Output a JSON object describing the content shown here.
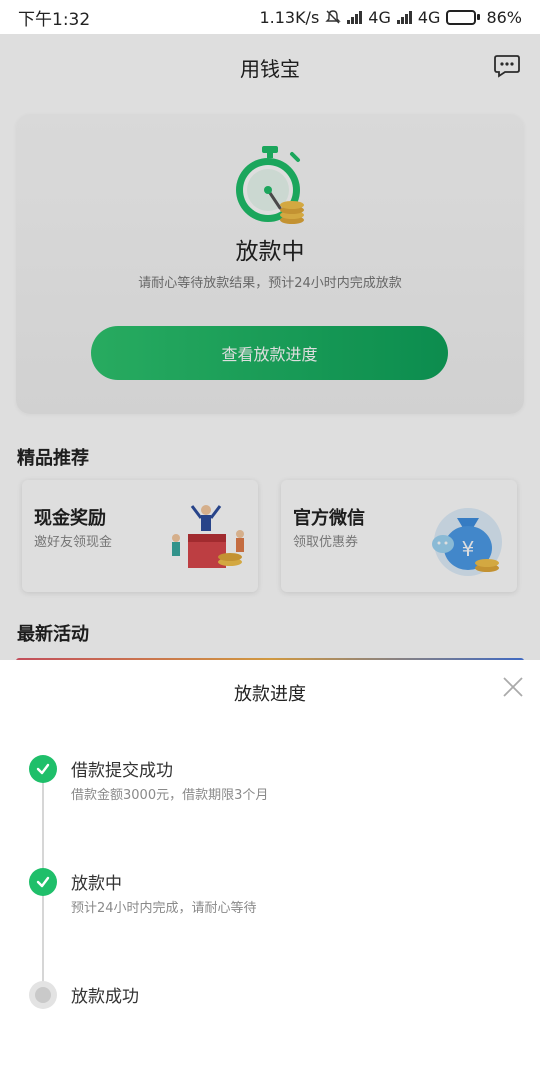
{
  "status_bar": {
    "time": "下午1:32",
    "network_speed": "1.13K/s",
    "sim1_label": "4G",
    "sim2_label": "4G",
    "battery_percent": "86%",
    "battery_level": 0.86
  },
  "app": {
    "title": "用钱宝",
    "header_icon": "message-icon",
    "loan_status": {
      "title": "放款中",
      "subtitle": "请耐心等待放款结果，预计24小时内完成放款",
      "button_label": "查看放款进度",
      "icon": "stopwatch-coins-icon",
      "accent_color": "#1fbf6a"
    },
    "featured": {
      "section_title": "精品推荐",
      "cards": [
        {
          "title": "现金奖励",
          "subtitle": "邀好友领现金",
          "icon": "cash-reward-illustration"
        },
        {
          "title": "官方微信",
          "subtitle": "领取优惠券",
          "icon": "wechat-money-bag-illustration"
        }
      ]
    },
    "activities": {
      "section_title": "最新活动"
    }
  },
  "sheet": {
    "title": "放款进度",
    "close_icon": "close-icon",
    "steps": [
      {
        "label": "借款提交成功",
        "desc": "借款金额3000元，借款期限3个月",
        "state": "done"
      },
      {
        "label": "放款中",
        "desc": "预计24小时内完成，请耐心等待",
        "state": "done"
      },
      {
        "label": "放款成功",
        "desc": "",
        "state": "pending"
      }
    ]
  }
}
